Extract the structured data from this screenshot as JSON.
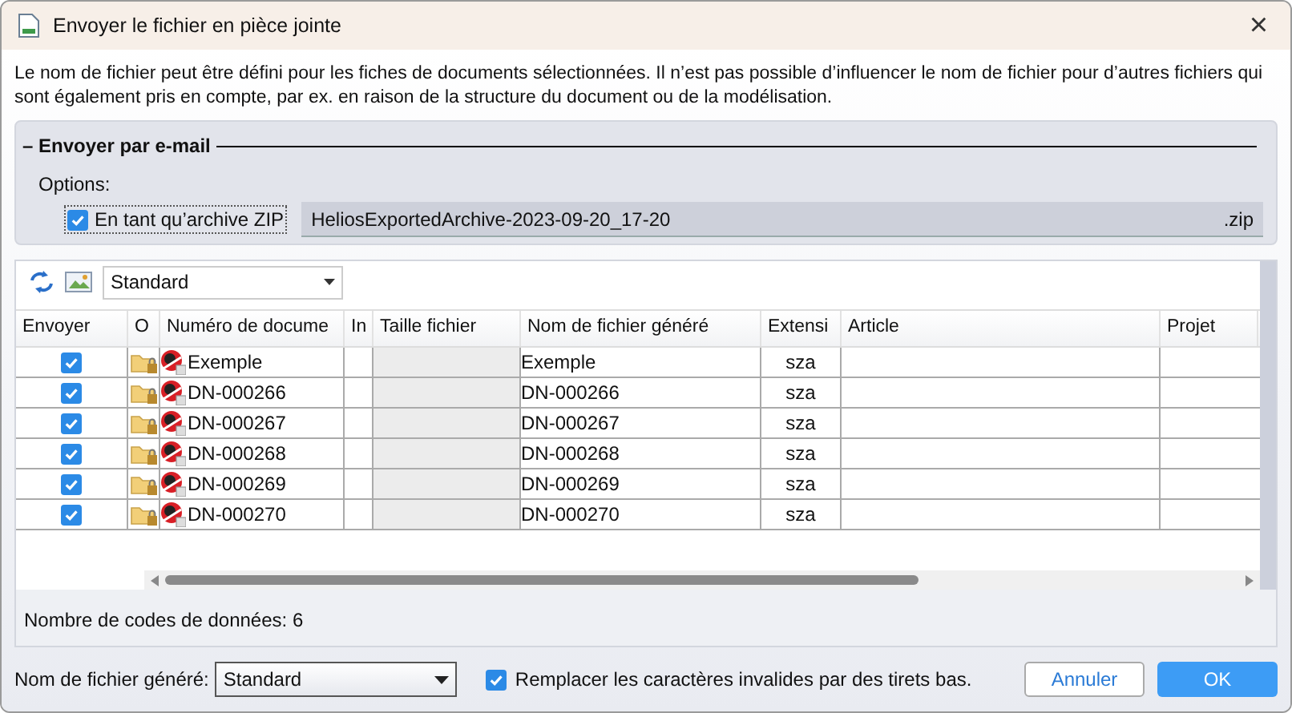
{
  "window": {
    "title": "Envoyer le fichier en pièce jointe",
    "close": "×"
  },
  "description": "Le nom de fichier peut être défini pour les fiches de documents sélectionnées. Il n’est pas possible d’influencer le nom de fichier pour d’autres fichiers qui sont également pris en compte, par ex. en raison de la structure du document ou de la modélisation.",
  "group": {
    "legend": "– Envoyer par e-mail",
    "options_label": "Options:",
    "zip_checkbox": {
      "label": "En tant qu’archive ZIP",
      "checked": true
    },
    "archive_name": {
      "value": "HeliosExportedArchive-2023-09-20_17-20",
      "suffix": ".zip"
    }
  },
  "toolbar": {
    "view_select": "Standard"
  },
  "table": {
    "columns": [
      "Envoyer",
      "O",
      "Numéro de docume",
      "In",
      "Taille fichier",
      "Nom de fichier généré",
      "Extensi",
      "Article",
      "Projet"
    ],
    "rows": [
      {
        "send": true,
        "number": "Exemple",
        "generated_name": "Exemple",
        "extension": "sza"
      },
      {
        "send": true,
        "number": "DN-000266",
        "generated_name": "DN-000266",
        "extension": "sza"
      },
      {
        "send": true,
        "number": "DN-000267",
        "generated_name": "DN-000267",
        "extension": "sza"
      },
      {
        "send": true,
        "number": "DN-000268",
        "generated_name": "DN-000268",
        "extension": "sza"
      },
      {
        "send": true,
        "number": "DN-000269",
        "generated_name": "DN-000269",
        "extension": "sza"
      },
      {
        "send": true,
        "number": "DN-000270",
        "generated_name": "DN-000270",
        "extension": "sza"
      }
    ]
  },
  "status": "Nombre de codes de données: 6",
  "footer": {
    "name_label": "Nom de fichier généré:",
    "name_select": "Standard",
    "replace_checkbox": {
      "label": "Remplacer les caractères invalides par des tirets bas.",
      "checked": true
    },
    "buttons": [
      "Annuler",
      "OK"
    ]
  }
}
